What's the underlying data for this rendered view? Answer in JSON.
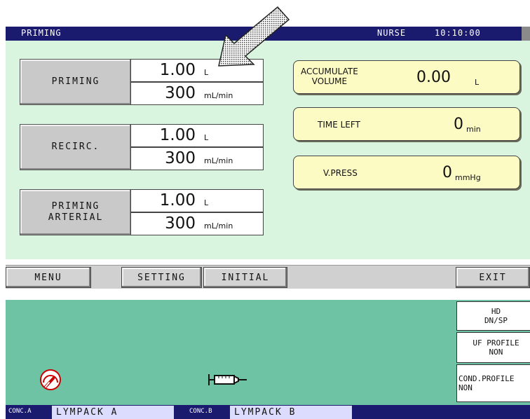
{
  "header": {
    "screen_title": "PRIMING",
    "user_role": "NURSE",
    "clock": "10:10:00"
  },
  "params": [
    {
      "label": "PRIMING",
      "volume": "1.00",
      "volume_unit": "L",
      "rate": "300",
      "rate_unit": "mL/min"
    },
    {
      "label": "RECIRC.",
      "volume": "1.00",
      "volume_unit": "L",
      "rate": "300",
      "rate_unit": "mL/min"
    },
    {
      "label": "PRIMING\nARTERIAL",
      "volume": "1.00",
      "volume_unit": "L",
      "rate": "300",
      "rate_unit": "mL/min"
    }
  ],
  "info": {
    "accumulate_volume": {
      "label": "ACCUMULATE\nVOLUME",
      "value": "0.00",
      "unit": "L"
    },
    "time_left": {
      "label": "TIME LEFT",
      "value": "0",
      "unit": "min"
    },
    "v_press": {
      "label": "V.PRESS",
      "value": "0",
      "unit": "mmHg"
    }
  },
  "menu": {
    "menu": "MENU",
    "setting": "SETTING",
    "initial": "INITIAL",
    "exit": "EXIT"
  },
  "status": {
    "mode": "HD\nDN/SP",
    "uf_profile": "UF PROFILE\nNON",
    "cond_profile": "COND.PROFILE\nNON"
  },
  "footer": {
    "conc_a_tag": "CONC.A",
    "conc_a_value": "LYMPACK A",
    "conc_b_tag": "CONC.B",
    "conc_b_value": "LYMPACK B"
  },
  "icons": [
    "pointer-arrow-icon",
    "gauge-icon",
    "syringe-icon"
  ],
  "colors": {
    "title_bar": "#1a1a6e",
    "main_panel": "#d9f5df",
    "lower_panel": "#6ec3a4",
    "info_button": "#fdfbc4",
    "button_gray": "#d3d3d3"
  }
}
